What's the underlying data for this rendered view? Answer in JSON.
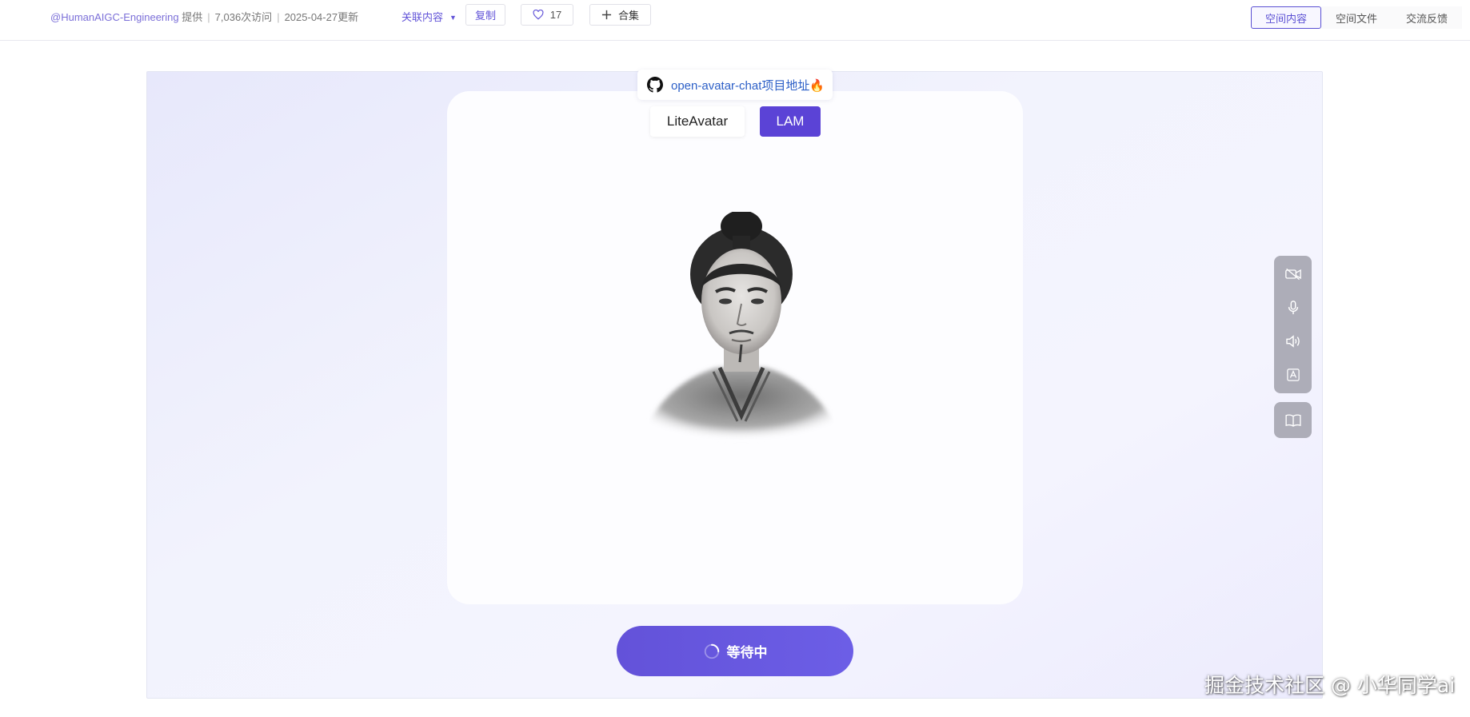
{
  "topbar": {
    "owner": "@HumanAIGC-Engineering",
    "provided": "提供",
    "visits": "7,036次访问",
    "updated": "2025-04-27更新",
    "related_label": "关联内容",
    "copy_label": "复制",
    "like_count": "17",
    "collect_label": "合集",
    "tabs": [
      {
        "label": "空间内容",
        "active": true
      },
      {
        "label": "空间文件",
        "active": false
      },
      {
        "label": "交流反馈",
        "active": false
      }
    ]
  },
  "main": {
    "github_link_text": "open-avatar-chat项目地址🔥",
    "avatar_tabs": [
      {
        "label": "LiteAvatar",
        "active": false
      },
      {
        "label": "LAM",
        "active": true
      }
    ],
    "controls": [
      "video-off-icon",
      "microphone-icon",
      "speaker-icon",
      "subtitle-icon"
    ],
    "side_control": "book-open-icon",
    "wait_button_label": "等待中"
  },
  "watermark": "掘金技术社区 @ 小华同学ai",
  "colors": {
    "accent": "#5b43d6",
    "link": "#2c5fc7",
    "control_bg": "#adadb8"
  }
}
